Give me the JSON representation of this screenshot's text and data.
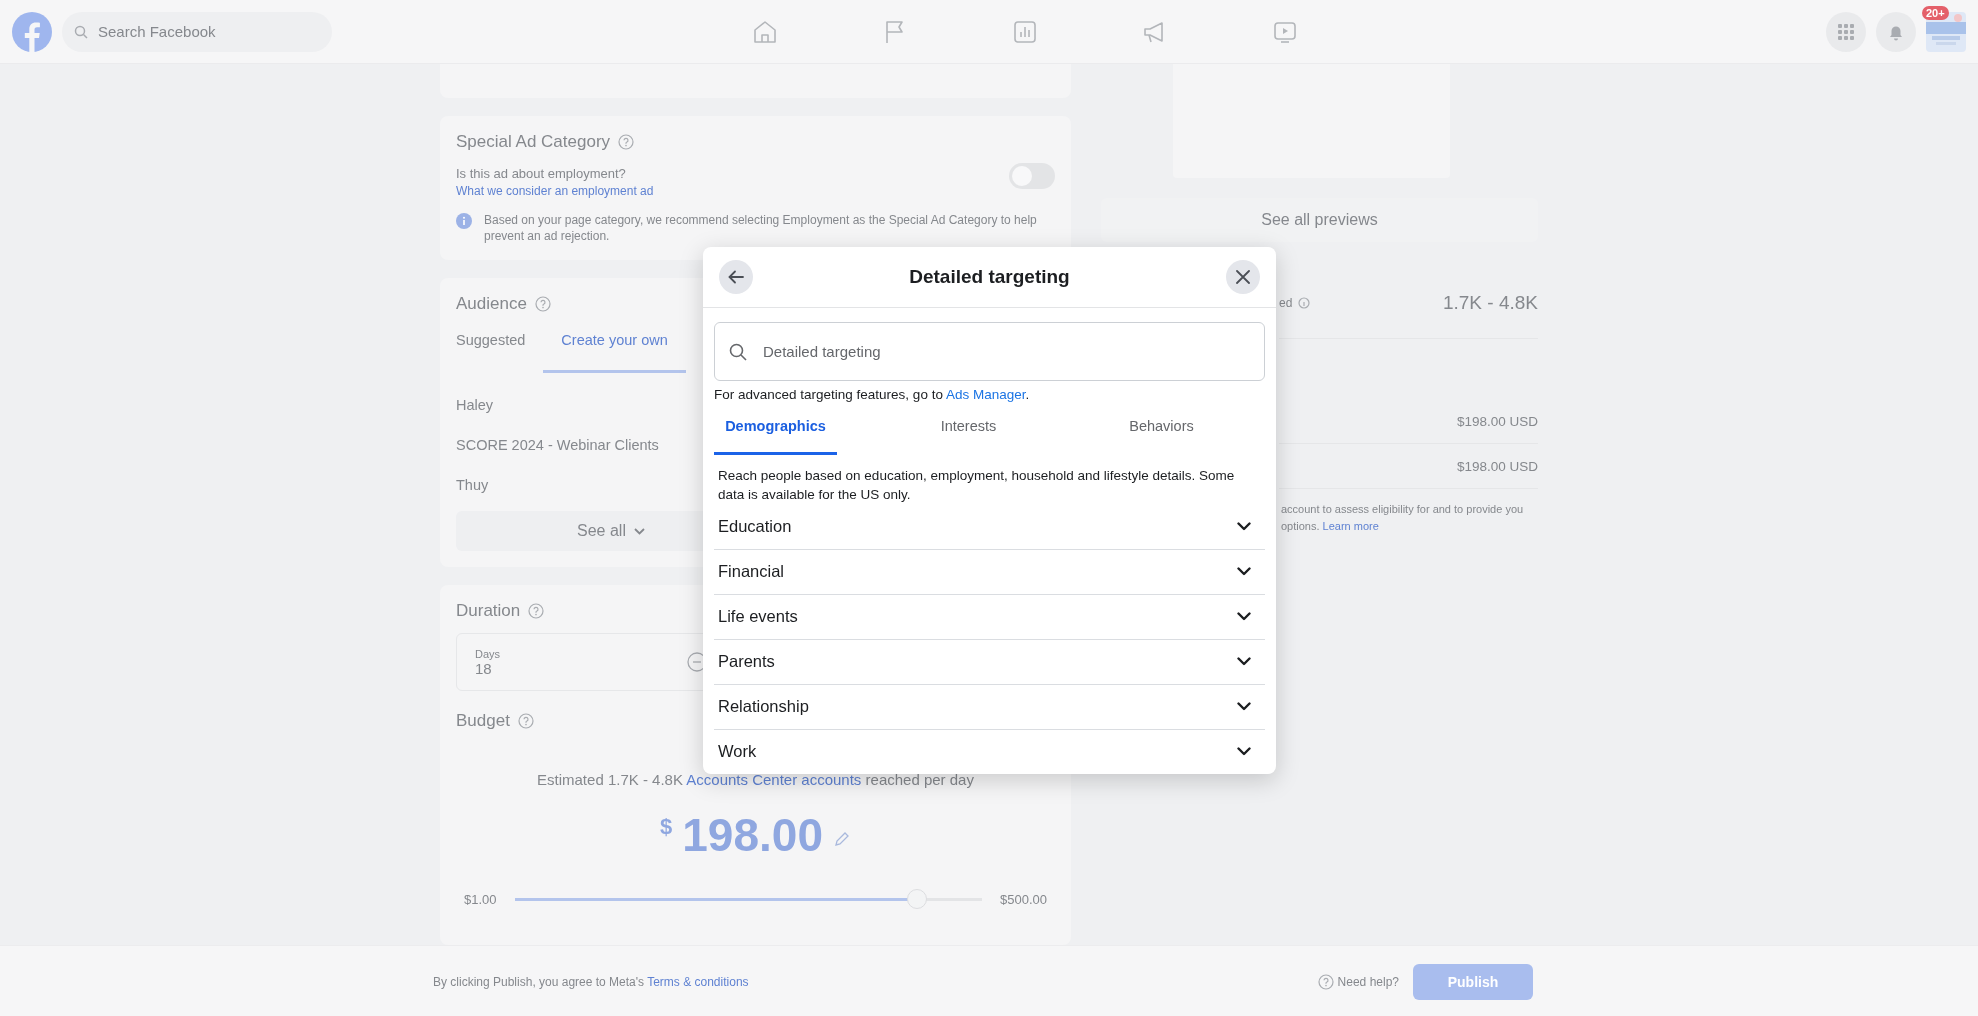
{
  "top_bar": {
    "search": {
      "placeholder": "Search Facebook"
    },
    "notification_badge": "20+"
  },
  "special_ad_category": {
    "title": "Special Ad Category",
    "question": "Is this ad about employment?",
    "link": "What we consider an employment ad",
    "toggle": {
      "on": false
    },
    "notice": "Based on your page category, we recommend selecting Employment as the Special Ad Category to help prevent an ad rejection."
  },
  "audience": {
    "title": "Audience",
    "tabs": [
      {
        "label": "Suggested",
        "selected": false
      },
      {
        "label": "Create your own",
        "selected": true
      }
    ],
    "items": [
      "Haley",
      "SCORE 2024 - Webinar Clients",
      "Thuy"
    ],
    "see_all": "See all"
  },
  "duration": {
    "title": "Duration",
    "field": {
      "label": "Days",
      "value": "18"
    }
  },
  "budget": {
    "title": "Budget",
    "estimate_prefix": "Estimated 1.7K - 4.8K",
    "estimate_link": "Accounts Center accounts",
    "estimate_suffix": "reached per day",
    "currency": "$",
    "amount": "198.00",
    "slider": {
      "min": "$1.00",
      "max": "$500.00",
      "level": 0.86
    }
  },
  "preview": {
    "see_all": "See all previews"
  },
  "summary": {
    "reach_label": "ed",
    "reach": "1.7K - 4.8K",
    "amounts": [
      "$198.00 USD",
      "$198.00 USD"
    ],
    "note_line": "account to assess eligibility for and to provide you",
    "note_end": "options.",
    "note_link": "Learn more"
  },
  "footer": {
    "terms_prefix": "By clicking Publish, you agree to Meta's",
    "terms_link": "Terms & conditions",
    "help": "Need help?",
    "publish": "Publish"
  },
  "modal": {
    "title": "Detailed targeting",
    "search": {
      "placeholder": "Detailed targeting"
    },
    "hint_prefix": "For advanced targeting features, go to",
    "hint_link": "Ads Manager",
    "hint_suffix": ".",
    "tabs": [
      {
        "label": "Demographics",
        "selected": true
      },
      {
        "label": "Interests",
        "selected": false
      },
      {
        "label": "Behaviors",
        "selected": false
      }
    ],
    "description": "Reach people based on education, employment, household and lifestyle details. Some data is available for the US only.",
    "categories": [
      {
        "label": "Education",
        "expanded": false
      },
      {
        "label": "Financial",
        "expanded": false
      },
      {
        "label": "Life events",
        "expanded": false
      },
      {
        "label": "Parents",
        "expanded": false
      },
      {
        "label": "Relationship",
        "expanded": false
      },
      {
        "label": "Work",
        "expanded": false
      }
    ]
  }
}
